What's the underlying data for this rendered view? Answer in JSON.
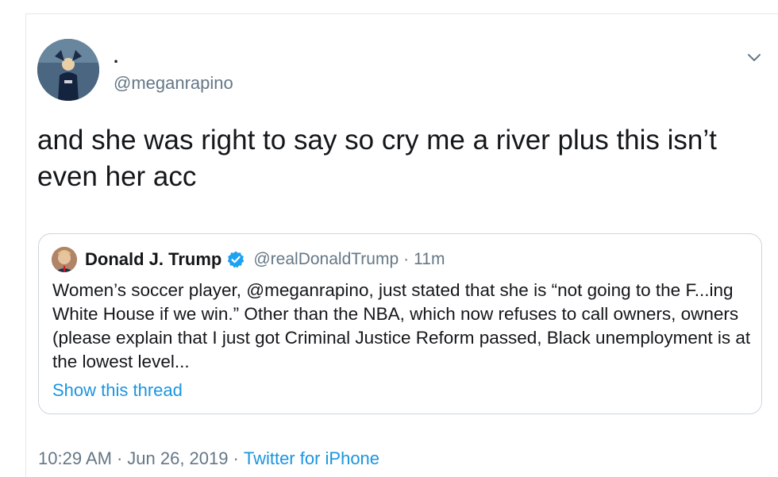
{
  "tweet": {
    "author_name": ".",
    "author_handle": "@meganrapino",
    "text": "and she was right to say so cry me a river plus this isn’t even her acc",
    "menu_icon": "chevron-down-icon"
  },
  "quoted_tweet": {
    "author_name": "Donald J. Trump",
    "verified_icon": "verified-badge-icon",
    "author_handle": "@realDonaldTrump",
    "separator": "·",
    "time": "11m",
    "text": "Women’s soccer player, @meganrapino, just stated that she is “not going to the F...ing White House if we win.” Other than the NBA, which now refuses to call owners, owners (please explain that I just got Criminal Justice Reform passed, Black unemployment is at the lowest level...",
    "thread_link": "Show this thread"
  },
  "footer": {
    "time": "10:29 AM",
    "separator": "·",
    "date": "Jun 26, 2019",
    "source": "Twitter for iPhone"
  },
  "colors": {
    "link": "#1b95e0",
    "secondary_text": "#657786",
    "border": "#ccd6dd"
  }
}
